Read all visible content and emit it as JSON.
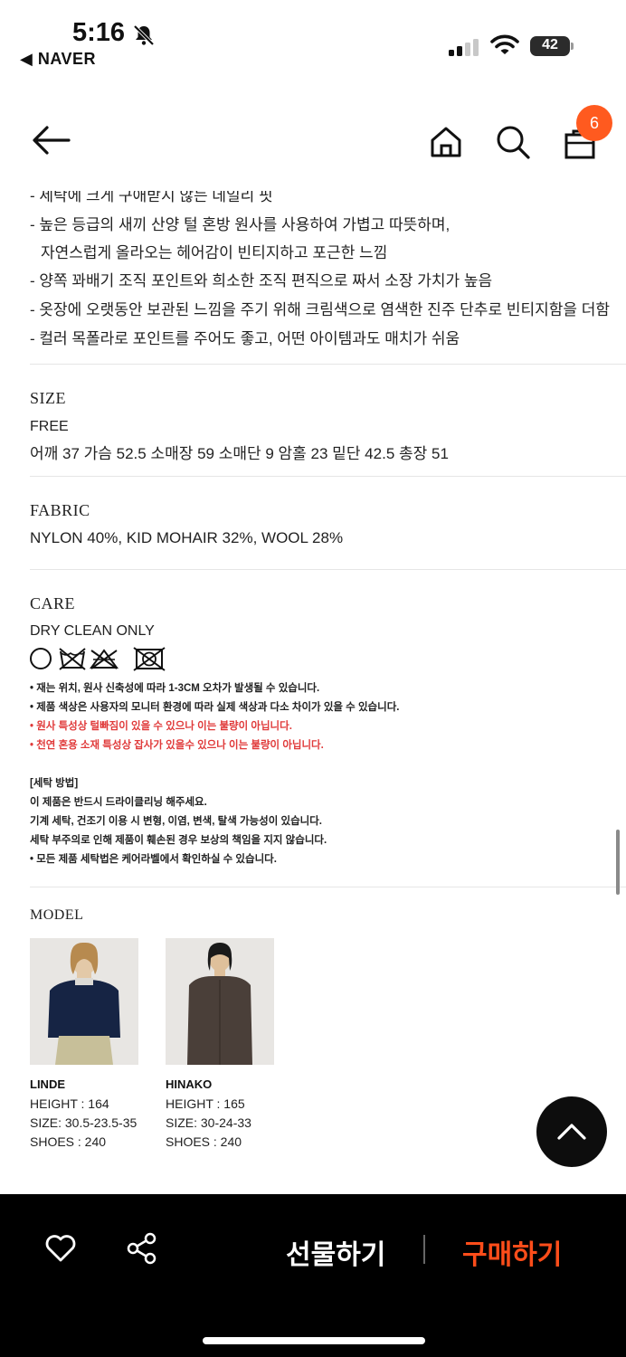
{
  "status_bar": {
    "time": "5:16",
    "back_app": "◀ NAVER",
    "battery": "42"
  },
  "nav": {
    "cart_badge": "6"
  },
  "description": {
    "lines": [
      "- 세탁에 크게 구애받지 않는 데일리 핏",
      "- 높은 등급의 새끼 산양 털 혼방 원사를 사용하여 가볍고 따뜻하며,",
      "  자연스럽게 올라오는 헤어감이 빈티지하고 포근한 느낌",
      "- 양쪽 꽈배기 조직 포인트와 희소한 조직 편직으로 짜서 소장 가치가 높음",
      "- 옷장에 오랫동안 보관된 느낌을 주기 위해 크림색으로 염색한 진주 단추로 빈티지함을 더함",
      "- 컬러 목폴라로 포인트를 주어도 좋고, 어떤 아이템과도 매치가 쉬움"
    ]
  },
  "size": {
    "title": "SIZE",
    "size_name": "FREE",
    "measurements": "어깨 37  가슴 52.5  소매장 59  소매단 9  암홀 23  밑단 42.5  총장 51"
  },
  "fabric": {
    "title": "FABRIC",
    "composition": "NYLON 40%, KID MOHAIR 32%, WOOL 28%"
  },
  "care": {
    "title": "CARE",
    "instruction": "DRY CLEAN ONLY",
    "icons": [
      "dry-clean-icon",
      "no-wash-icon",
      "no-tumble-dry-icon",
      "no-bleach-icon"
    ],
    "notes": [
      "• 재는 위치, 원사 신축성에 따라 1-3CM 오차가 발생될 수 있습니다.",
      "• 제품 색상은 사용자의 모니터 환경에 따라 실제 색상과 다소 차이가 있을 수 있습니다."
    ],
    "red_notes": [
      "• 원사 특성상 털빠짐이 있을 수 있으나 이는 불량이 아닙니다.",
      "• 천연 혼용 소재 특성상 잡사가 있을수 있으나 이는 불량이 아닙니다."
    ],
    "wash_title": "[세탁 방법]",
    "wash_lines": [
      "이 제품은 반드시 드라이클리닝 해주세요.",
      "기계 세탁, 건조기 이용 시 변형, 이염, 변색, 탈색 가능성이 있습니다.",
      "세탁 부주의로 인해 제품이 훼손된 경우 보상의 책임을 지지 않습니다.",
      "• 모든 제품 세탁법은 케어라벨에서 확인하실 수 있습니다."
    ]
  },
  "model": {
    "title": "MODEL",
    "models": [
      {
        "name": "LINDE",
        "height": "HEIGHT : 164",
        "size": "SIZE: 30.5-23.5-35",
        "shoes": "SHOES : 240"
      },
      {
        "name": "HINAKO",
        "height": "HEIGHT : 165",
        "size": "SIZE: 30-24-33",
        "shoes": "SHOES : 240"
      }
    ]
  },
  "bottom_bar": {
    "gift_label": "선물하기",
    "buy_label": "구매하기"
  },
  "colors": {
    "accent": "#ff4d1a",
    "badge": "#ff5a1f",
    "bottom_bar": "#000000",
    "warning_text": "#e03a3a"
  }
}
